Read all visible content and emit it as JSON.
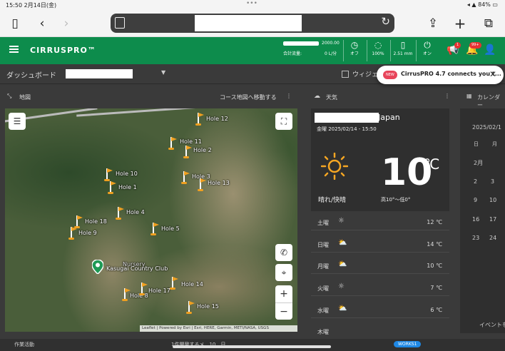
{
  "status": {
    "time": "15:50",
    "date": "2月14日(金)",
    "battery": "84%"
  },
  "app": {
    "logo": "CIRRUSPRO™"
  },
  "flow": {
    "value": "2000.00",
    "label": "合計流量:",
    "rate": "0 L/分"
  },
  "stats": [
    {
      "icon": "clock-icon",
      "label": "オフ"
    },
    {
      "icon": "drop-icon",
      "label": "100%"
    },
    {
      "icon": "gauge-icon",
      "label": "2.51 mm"
    },
    {
      "icon": "power-icon",
      "label": "オン"
    }
  ],
  "badges": {
    "announce": "1",
    "notify": "99+"
  },
  "dashboard": {
    "title": "ダッシュボード",
    "widget_label": "ウィジェ"
  },
  "toast": {
    "new": "NEW",
    "message": "CirrusPRO 4.7 connects you t..."
  },
  "map": {
    "title": "地図",
    "goto": "コース地図へ移動する",
    "club": "Kasugai Country Club",
    "nursery": "Nursery",
    "attribution": "Leaflet | Powered by Esri | Esri, HERE, Garmin, METI/NASA, USGS",
    "holes": [
      "Hole 12",
      "Hole 11",
      "Hole 2",
      "Hole 10",
      "Hole 1",
      "Hole 3",
      "Hole 13",
      "Hole 4",
      "Hole 18",
      "Hole 5",
      "Hole 9",
      "Hole 8",
      "Hole 17",
      "Hole 14",
      "Hole 15"
    ]
  },
  "weather": {
    "title": "天気",
    "location": "Japan",
    "datetime": "金曜 2025/02/14 - 15:50",
    "temp": "10",
    "unit": "℃",
    "desc": "晴れ/快晴",
    "range": "高10°～低0°",
    "days": [
      {
        "day": "土曜",
        "temp": "12 ℃"
      },
      {
        "day": "日曜",
        "temp": "14 ℃"
      },
      {
        "day": "月曜",
        "temp": "10 ℃"
      },
      {
        "day": "火曜",
        "temp": "7 ℃"
      },
      {
        "day": "水曜",
        "temp": "6 ℃"
      },
      {
        "day": "木曜",
        "temp": ""
      }
    ]
  },
  "calendar": {
    "title": "カレンダー",
    "date": "2025/02/1",
    "weekdays": [
      "日",
      "月"
    ],
    "month": "2月",
    "rows": [
      [
        "2",
        "3"
      ],
      [
        "9",
        "10"
      ],
      [
        "16",
        "17"
      ],
      [
        "23",
        "24"
      ]
    ],
    "event": "イベントを"
  },
  "bottom": {
    "left": "作業活動",
    "mid": "1件開発するメ…10…日",
    "chip": "WORKS1"
  }
}
